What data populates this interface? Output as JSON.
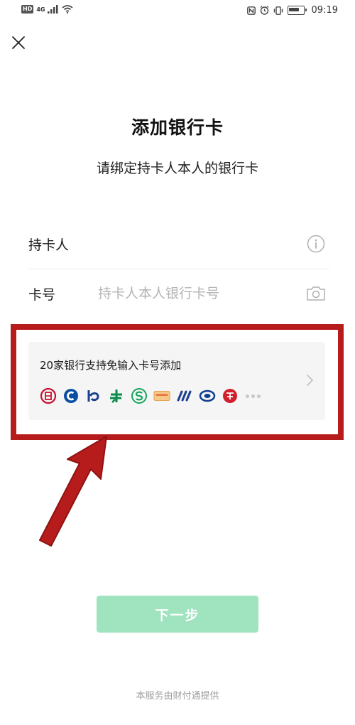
{
  "status_bar": {
    "hd_badge": "HD",
    "network_badge": "4G",
    "time": "09:19"
  },
  "header": {
    "title": "添加银行卡",
    "subtitle": "请绑定持卡人本人的银行卡"
  },
  "form": {
    "holder_label": "持卡人",
    "holder_value": "",
    "card_label": "卡号",
    "card_placeholder": "持卡人本人银行卡号"
  },
  "quick_add": {
    "title": "20家银行支持免输入卡号添加",
    "banks": [
      "icbc-logo",
      "ccb-logo",
      "boc-logo",
      "abc-logo",
      "cmbc-logo",
      "psbc-logo",
      "cib-logo",
      "spdb-logo",
      "citic-logo"
    ]
  },
  "next_button_label": "下一步",
  "footer": "本服务由财付通提供",
  "colors": {
    "accent_green": "#9fe3bf",
    "highlight_red": "#b71c1c",
    "placeholder_gray": "#b4b4b4"
  }
}
